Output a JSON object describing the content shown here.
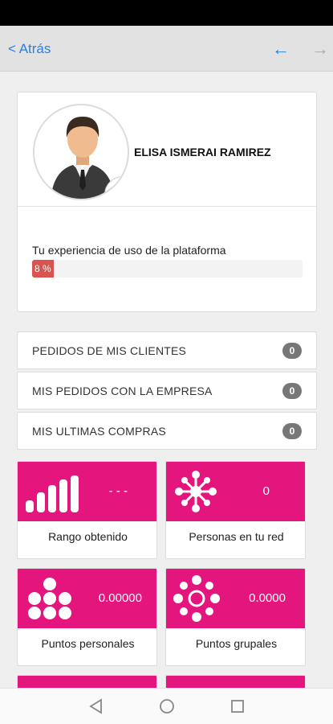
{
  "nav": {
    "back_label": "< Atrás",
    "arrow_left": "←",
    "arrow_right": "→"
  },
  "profile": {
    "name": "ELISA ISMERAI RAMIREZ",
    "experience_label": "Tu experiencia de uso de la plataforma",
    "experience_value": 8,
    "experience_text": "8 %"
  },
  "order_rows": [
    {
      "label": "PEDIDOS DE MIS CLIENTES",
      "count": "0"
    },
    {
      "label": "MIS PEDIDOS CON LA EMPRESA",
      "count": "0"
    },
    {
      "label": "MIS ULTIMAS COMPRAS",
      "count": "0"
    }
  ],
  "stats": [
    {
      "label": "Rango obtenido",
      "value": "- - -",
      "icon": "bars-chart-icon"
    },
    {
      "label": "Personas en tu red",
      "value": "0",
      "icon": "network-icon"
    },
    {
      "label": "Puntos personales",
      "value": "0.00000",
      "icon": "dots-cluster-icon"
    },
    {
      "label": "Puntos grupales",
      "value": "0.0000",
      "icon": "dots-ring-icon"
    }
  ],
  "colors": {
    "accent": "#e5157e",
    "link": "#2a7fe0",
    "progress": "#d9534f",
    "badge": "#777777"
  }
}
